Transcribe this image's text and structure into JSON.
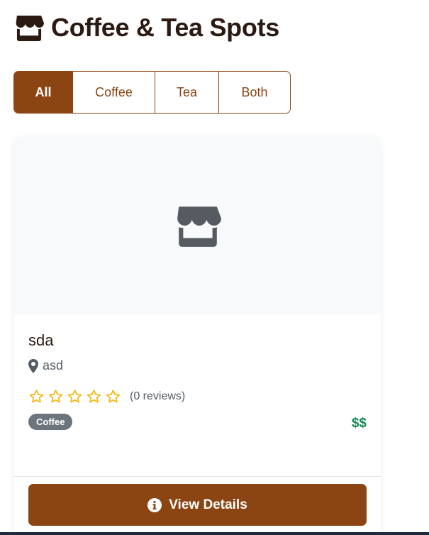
{
  "header": {
    "title": "Coffee & Tea Spots",
    "icon": "store-icon"
  },
  "filters": {
    "items": [
      {
        "label": "All",
        "active": true
      },
      {
        "label": "Coffee",
        "active": false
      },
      {
        "label": "Tea",
        "active": false
      },
      {
        "label": "Both",
        "active": false
      }
    ]
  },
  "card": {
    "image_icon": "store-icon",
    "name": "sda",
    "location": "asd",
    "rating": 0,
    "max_rating": 5,
    "reviews_text": "(0 reviews)",
    "badge": "Coffee",
    "price": "$$",
    "button_label": "View Details",
    "button_icon": "info-circle-icon"
  },
  "colors": {
    "brand": "#8b4513",
    "star": "#f5b301",
    "price": "#198754",
    "badge": "#6c757d",
    "icon_gray": "#555b61"
  }
}
